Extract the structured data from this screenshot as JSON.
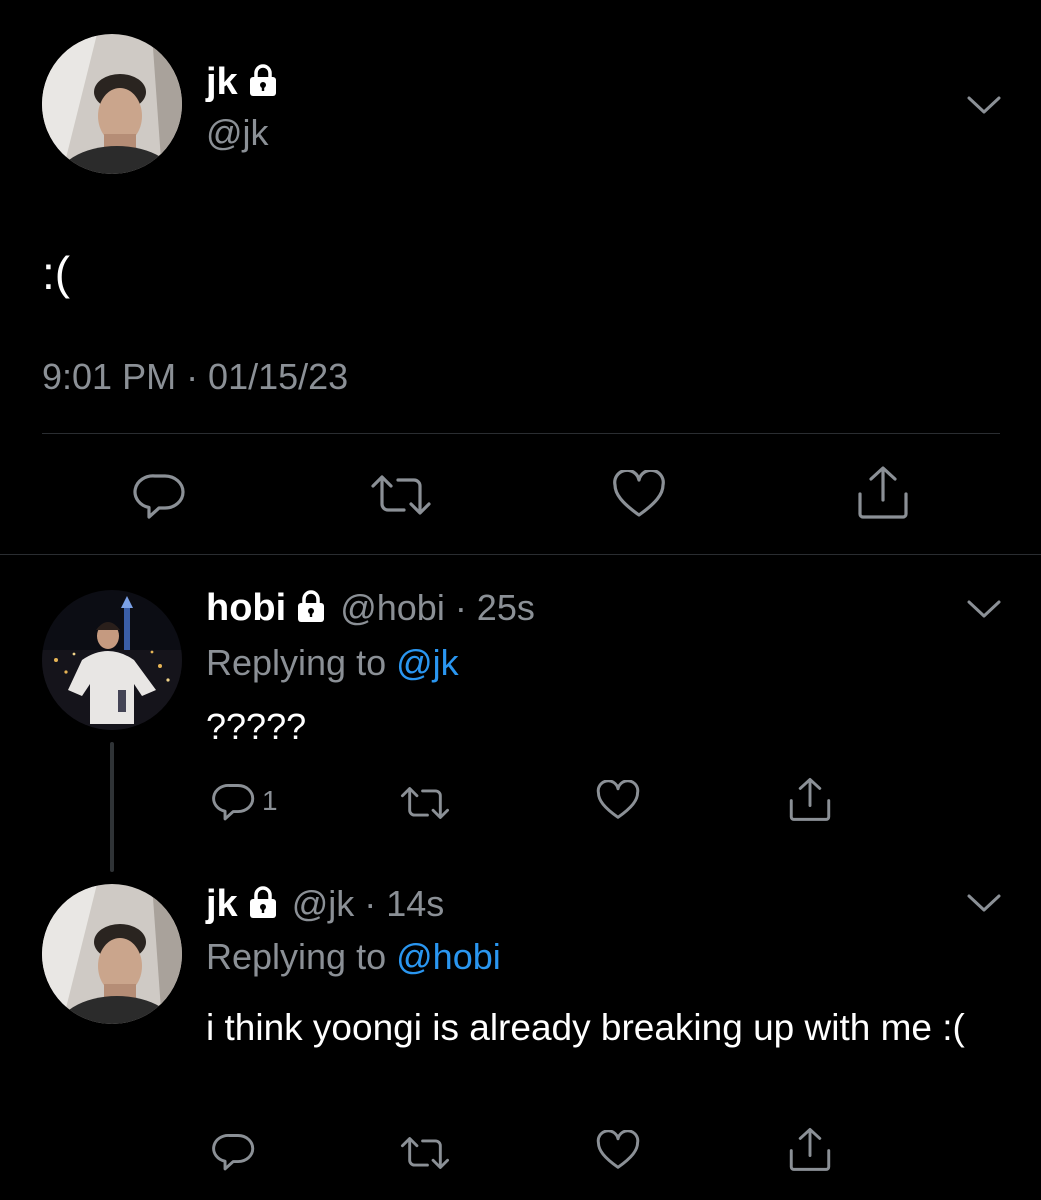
{
  "main_tweet": {
    "display_name": "jk",
    "handle": "@jk",
    "text": ":(",
    "timestamp": "9:01 PM · 01/15/23",
    "locked_icon": "lock-icon",
    "menu_icon": "chevron-down-icon"
  },
  "replies": [
    {
      "display_name": "hobi",
      "handle_time": "@hobi · 25s",
      "replying_label": "Replying to",
      "replying_to": "@jk",
      "text": "?????",
      "reply_count": "1"
    },
    {
      "display_name": "jk",
      "handle_time": "@jk · 14s",
      "replying_label": "Replying to",
      "replying_to": "@hobi",
      "text": "i think yoongi is already breaking up with me :(",
      "reply_count": ""
    }
  ],
  "colors": {
    "background": "#000000",
    "text": "#ffffff",
    "muted": "#8b9096",
    "link": "#2a96f0",
    "divider": "#2a2d31"
  }
}
